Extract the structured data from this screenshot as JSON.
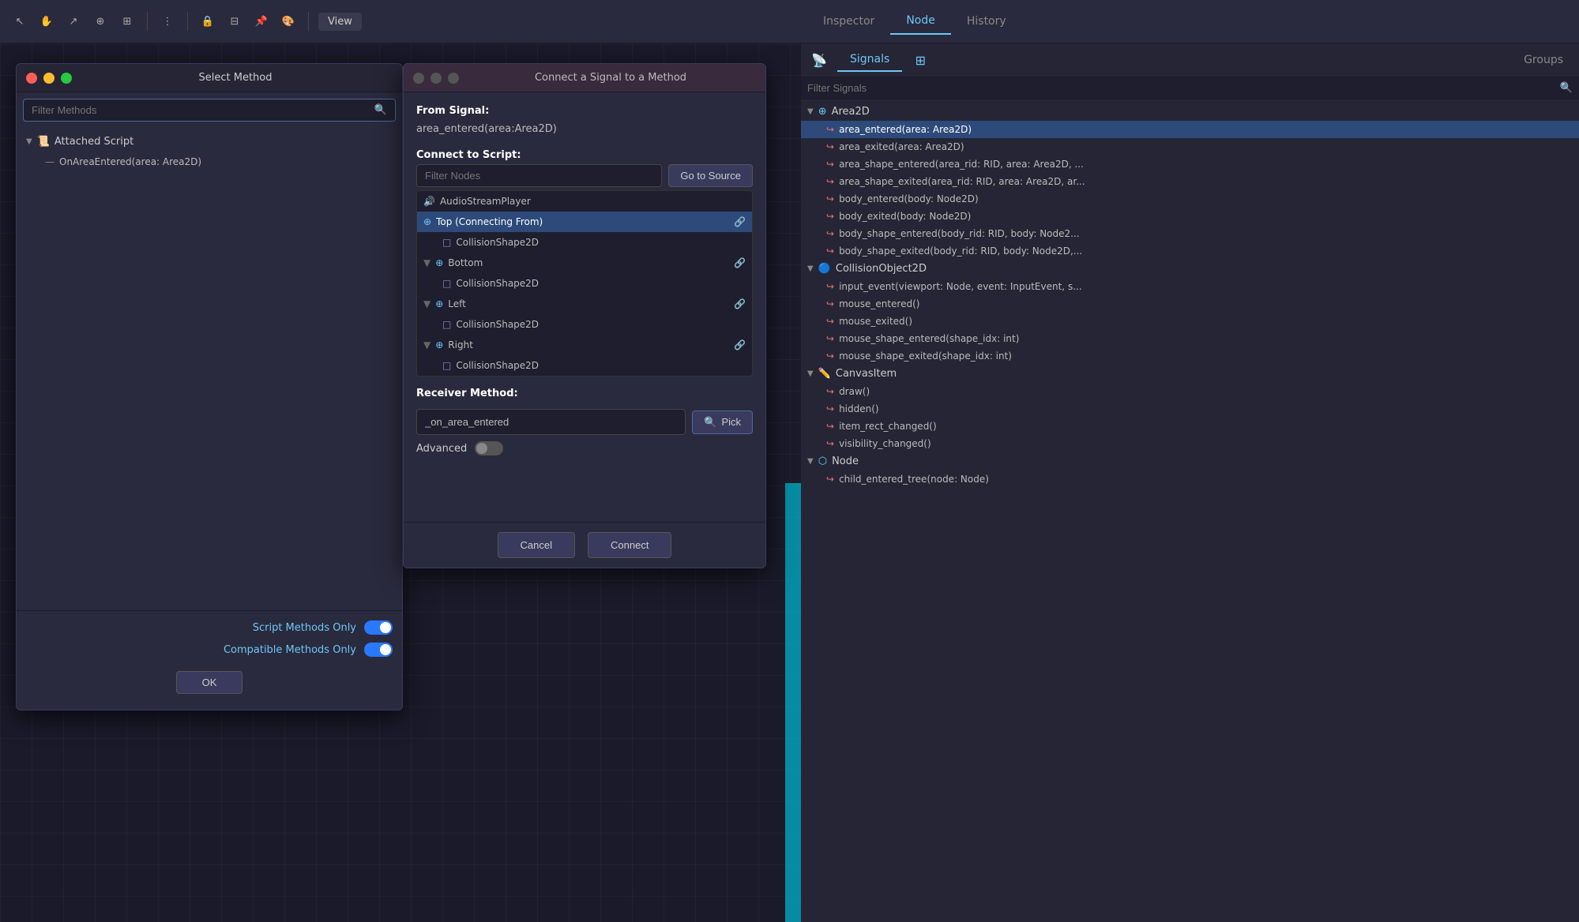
{
  "toolbar": {
    "view_label": "View",
    "fullscreen_title": "⛶"
  },
  "select_method_window": {
    "title": "Select Method",
    "search_placeholder": "Filter Methods",
    "tree": {
      "group_label": "Attached Script",
      "group_icon": "📜",
      "method": "OnAreaEntered(area: Area2D)"
    },
    "toggles": {
      "script_methods_only": "Script Methods Only",
      "compatible_methods_only": "Compatible Methods Only"
    },
    "ok_button": "OK"
  },
  "connect_window": {
    "title": "Connect a Signal to a Method",
    "from_signal_label": "From Signal:",
    "from_signal_value": "area_entered(area:Area2D)",
    "connect_to_script_label": "Connect to Script:",
    "filter_nodes_placeholder": "Filter Nodes",
    "go_to_source_label": "Go to Source",
    "nodes": [
      {
        "name": "AudioStreamPlayer",
        "type": "audio",
        "indent": 0,
        "has_connect": false
      },
      {
        "name": "Top (Connecting From)",
        "type": "area2d",
        "indent": 0,
        "selected": true,
        "has_connect": true
      },
      {
        "name": "CollisionShape2D",
        "type": "collision",
        "indent": 1,
        "has_connect": false
      },
      {
        "name": "Bottom",
        "type": "area2d",
        "indent": 0,
        "has_connect": true
      },
      {
        "name": "CollisionShape2D",
        "type": "collision",
        "indent": 1,
        "has_connect": false
      },
      {
        "name": "Left",
        "type": "area2d",
        "indent": 0,
        "has_connect": true
      },
      {
        "name": "CollisionShape2D",
        "type": "collision",
        "indent": 1,
        "has_connect": false
      },
      {
        "name": "Right",
        "type": "area2d",
        "indent": 0,
        "has_connect": true
      },
      {
        "name": "CollisionShape2D",
        "type": "collision",
        "indent": 1,
        "has_connect": false
      }
    ],
    "receiver_method_label": "Receiver Method:",
    "receiver_method_value": "_on_area_entered",
    "pick_button": "Pick",
    "advanced_label": "Advanced",
    "cancel_button": "Cancel",
    "connect_button": "Connect"
  },
  "right_panel": {
    "tabs": [
      "Inspector",
      "Node",
      "History"
    ],
    "active_tab": "Node",
    "sub_tabs": [
      "Signals",
      "Groups"
    ],
    "active_sub_tab": "Signals",
    "filter_placeholder": "Filter Signals",
    "signals": {
      "groups": [
        {
          "name": "Area2D",
          "icon": "area2d",
          "signals": [
            {
              "name": "area_entered(area: Area2D)",
              "selected": true
            },
            {
              "name": "area_exited(area: Area2D)"
            },
            {
              "name": "area_shape_entered(area_rid: RID, area: Area2D, ..."
            },
            {
              "name": "area_shape_exited(area_rid: RID, area: Area2D, ar..."
            },
            {
              "name": "body_entered(body: Node2D)"
            },
            {
              "name": "body_exited(body: Node2D)"
            },
            {
              "name": "body_shape_entered(body_rid: RID, body: Node2..."
            },
            {
              "name": "body_shape_exited(body_rid: RID, body: Node2D,..."
            }
          ]
        },
        {
          "name": "CollisionObject2D",
          "icon": "collision",
          "signals": [
            {
              "name": "input_event(viewport: Node, event: InputEvent, s..."
            },
            {
              "name": "mouse_entered()"
            },
            {
              "name": "mouse_exited()"
            },
            {
              "name": "mouse_shape_entered(shape_idx: int)"
            },
            {
              "name": "mouse_shape_exited(shape_idx: int)"
            }
          ]
        },
        {
          "name": "CanvasItem",
          "icon": "canvas",
          "signals": [
            {
              "name": "draw()"
            },
            {
              "name": "hidden()"
            },
            {
              "name": "item_rect_changed()"
            },
            {
              "name": "visibility_changed()"
            }
          ]
        },
        {
          "name": "Node",
          "icon": "node",
          "signals": [
            {
              "name": "child_entered_tree(node: Node)"
            }
          ]
        }
      ]
    }
  }
}
